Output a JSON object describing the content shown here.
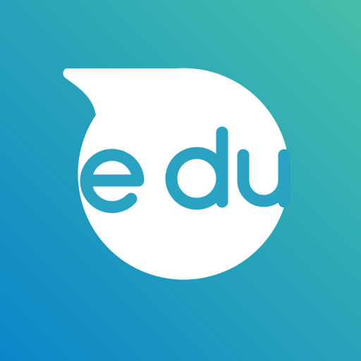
{
  "logo": {
    "word": "edu",
    "letters": [
      "e",
      "d",
      "u"
    ]
  },
  "colors": {
    "gradient_top_right": "#46BFAA",
    "gradient_bottom_left": "#0A86C9",
    "bubble": "#FFFFFF",
    "logo_text": "#2AA2C2"
  }
}
